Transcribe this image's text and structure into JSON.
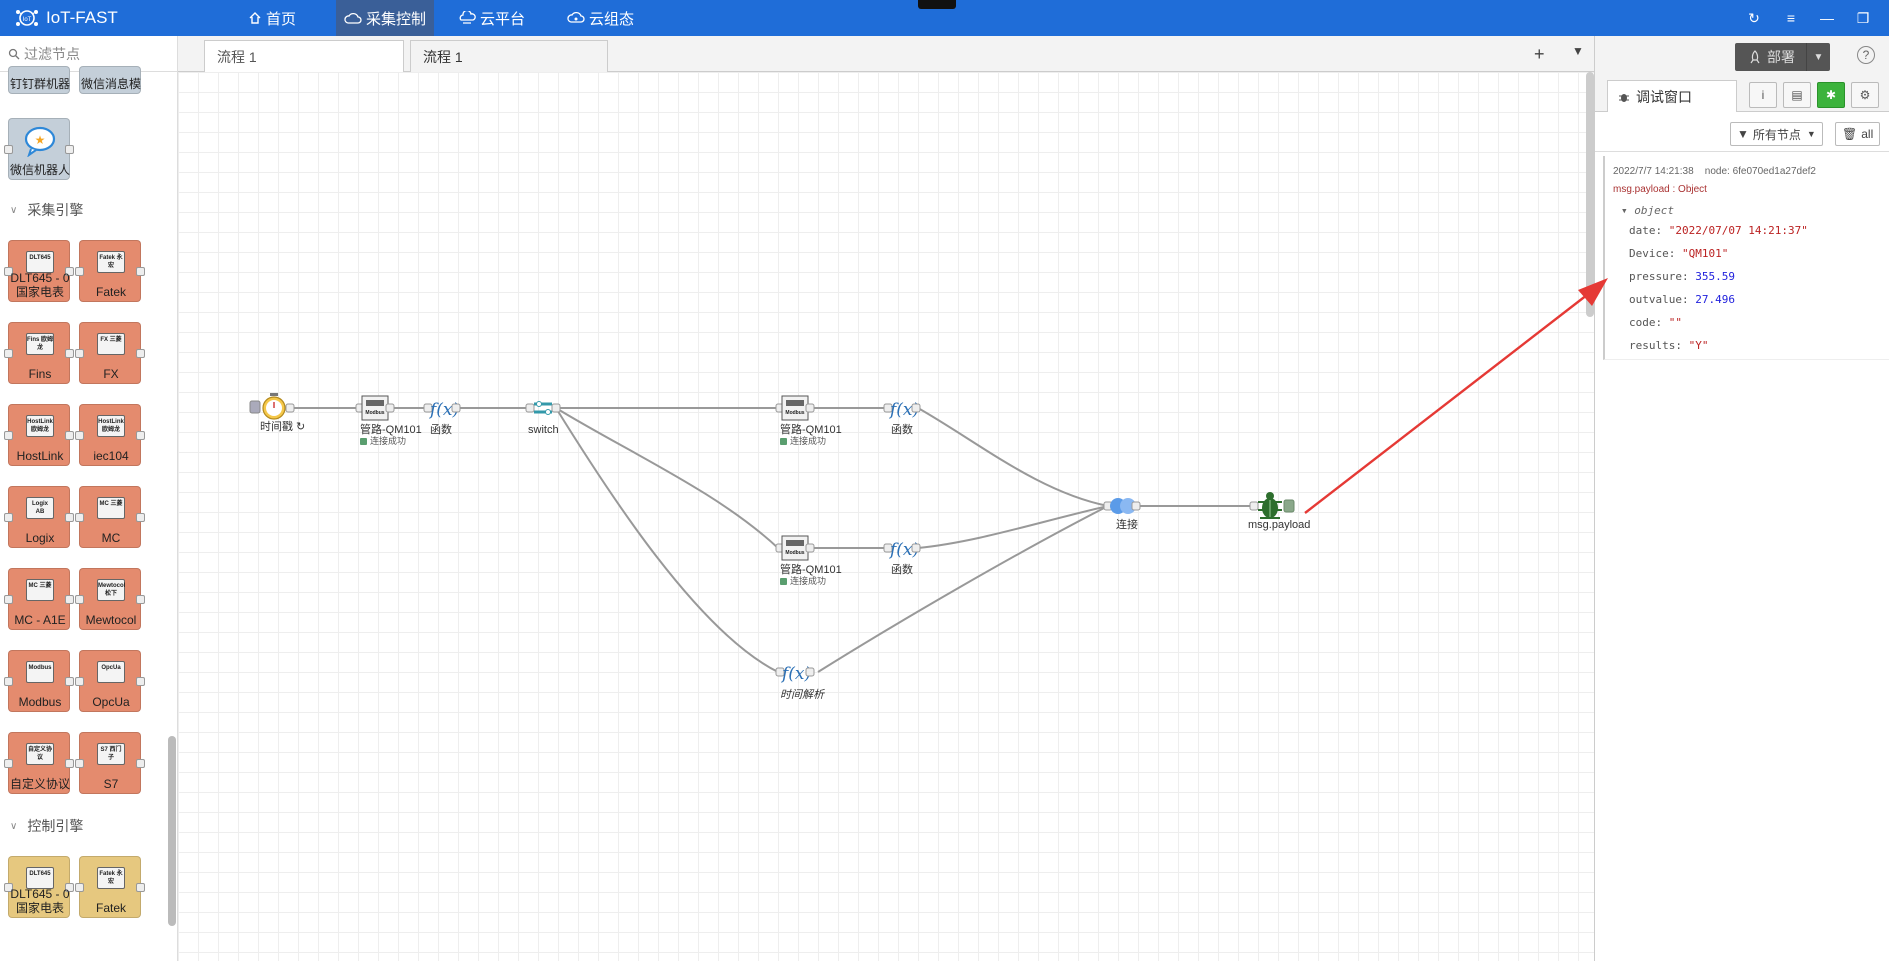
{
  "app": {
    "title": "IoT-FAST"
  },
  "nav": [
    {
      "label": "首页",
      "icon": "home-icon"
    },
    {
      "label": "采集控制",
      "icon": "cloud-icon"
    },
    {
      "label": "云平台",
      "icon": "platform-icon"
    },
    {
      "label": "云组态",
      "icon": "cloud-config-icon"
    }
  ],
  "palette": {
    "filter_placeholder": "过滤节点",
    "top_nodes": [
      {
        "label": "钉钉群机器"
      },
      {
        "label": "微信消息模"
      },
      {
        "label": "微信机器人"
      }
    ],
    "categories": [
      {
        "label": "采集引擎",
        "nodes": [
          {
            "label": "DLT645 - 0 国家电表",
            "chip": "DLT645"
          },
          {
            "label": "Fatek",
            "chip": "Fatek 永宏"
          },
          {
            "label": "Fins",
            "chip": "Fins 欧姆龙"
          },
          {
            "label": "FX",
            "chip": "FX 三菱"
          },
          {
            "label": "HostLink",
            "chip": "HostLink 欧姆龙"
          },
          {
            "label": "iec104",
            "chip": "HostLink 欧姆龙"
          },
          {
            "label": "Logix",
            "chip": "Logix AB"
          },
          {
            "label": "MC",
            "chip": "MC 三菱"
          },
          {
            "label": "MC - A1E",
            "chip": "MC 三菱"
          },
          {
            "label": "Mewtocol",
            "chip": "Mewtocol 松下"
          },
          {
            "label": "Modbus",
            "chip": "Modbus"
          },
          {
            "label": "OpcUa",
            "chip": "OpcUa"
          },
          {
            "label": "自定义协议",
            "chip": "自定义协议"
          },
          {
            "label": "S7",
            "chip": "S7 西门子"
          }
        ]
      },
      {
        "label": "控制引擎",
        "nodes": [
          {
            "label": "DLT645 - 0 国家电表",
            "chip": "DLT645"
          },
          {
            "label": "Fatek",
            "chip": "Fatek 永宏"
          }
        ]
      }
    ]
  },
  "tabs": [
    {
      "label": "流程 1"
    },
    {
      "label": "流程 1"
    }
  ],
  "flow": {
    "nodes": {
      "inject": "时间戳 ↻",
      "modbus1": "管路-QM101",
      "status1": "连接成功",
      "func1": "函数",
      "switch": "switch",
      "modbus2": "管路-QM101",
      "status2": "连接成功",
      "func2": "函数",
      "modbus3": "管路-QM101",
      "status3": "连接成功",
      "func3": "函数",
      "func4": "时间解析",
      "join": "连接",
      "debug": "msg.payload"
    },
    "colors": {
      "wire": "#999999",
      "status": "#5a9e6f",
      "debug_node": "#2d6e2d",
      "arrow": "#e53935"
    }
  },
  "sidebar": {
    "deploy_label": "部署",
    "tab_label": "调试窗口",
    "filter_label": "所有节点",
    "clear_label": "all",
    "debug": {
      "timestamp": "2022/7/7 14:21:38",
      "node": "node: 6fe070ed1a27def2",
      "topic": "msg.payload : Object",
      "object_label": "object",
      "fields": [
        {
          "key": "date",
          "value": "\"2022/07/07 14:21:37\"",
          "kind": "s"
        },
        {
          "key": "Device",
          "value": "\"QM101\"",
          "kind": "s"
        },
        {
          "key": "pressure",
          "value": "355.59",
          "kind": "n"
        },
        {
          "key": "outvalue",
          "value": "27.496",
          "kind": "n"
        },
        {
          "key": "code",
          "value": "\"\"",
          "kind": "s"
        },
        {
          "key": "results",
          "value": "\"Y\"",
          "kind": "s"
        }
      ]
    }
  }
}
